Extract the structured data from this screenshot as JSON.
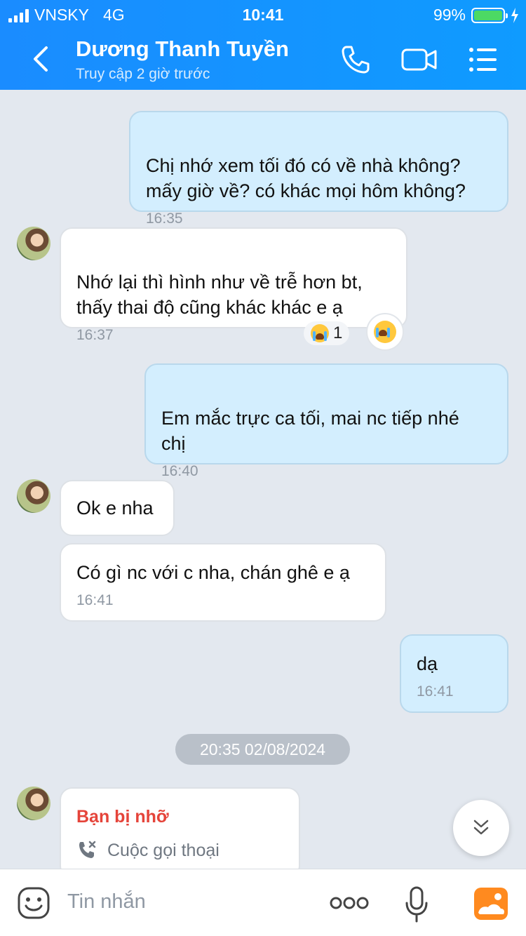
{
  "status_bar": {
    "carrier": "VNSKY",
    "network": "4G",
    "time": "10:41",
    "battery": "99%",
    "battery_level": 0.99
  },
  "header": {
    "title": "Dương Thanh Tuyền",
    "subtitle": "Truy cập 2 giờ trước"
  },
  "messages": [
    {
      "from": "me",
      "text": "Chị nhớ xem tối đó có về nhà không?\nmấy giờ về? có khác mọi hôm không?",
      "time": "16:35"
    },
    {
      "from": "them",
      "text": "Nhớ lại thì hình như về trễ hơn bt,\nthấy thai độ cũng khác khác e ạ",
      "time": "16:37",
      "reaction_count": "1"
    },
    {
      "from": "me",
      "text": "Em mắc trực ca tối, mai nc tiếp nhé\nchị",
      "time": "16:40"
    },
    {
      "from": "them",
      "text": "Ok e nha"
    },
    {
      "from": "them",
      "text": "Có gì nc với c nha, chán ghê e ạ",
      "time": "16:41"
    },
    {
      "from": "me",
      "text": "dạ",
      "time": "16:41"
    }
  ],
  "date_divider": "20:35 02/08/2024",
  "missed_call": {
    "title": "Bạn bị nhỡ",
    "label": "Cuộc gọi thoại"
  },
  "input": {
    "placeholder": "Tin nhắn"
  },
  "colors": {
    "header": "#1a8cff",
    "my_bubble": "#d3eefe",
    "their_bubble": "#ffffff",
    "missed": "#e5443a",
    "background": "#e3e8ef"
  }
}
